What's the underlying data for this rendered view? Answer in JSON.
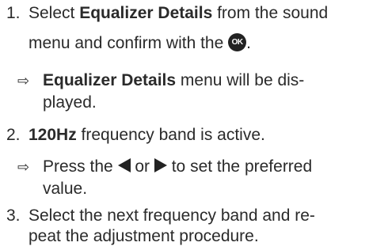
{
  "steps": [
    {
      "number": "1.",
      "line1_pre": "Select ",
      "line1_bold": "Equalizer Details",
      "line1_post": " from the sound",
      "line2_pre": "menu and confirm with the ",
      "ok_label": "OK",
      "line2_post": ".",
      "result_arrow": "⇨",
      "result_bold": "Equalizer Details",
      "result_line1_post": " menu will be dis-",
      "result_line2": "played."
    },
    {
      "number": "2.",
      "bold": "120Hz",
      "post": " frequency band is active.",
      "result_arrow": "⇨",
      "result_pre": "Press the ",
      "result_mid": " or ",
      "result_post": " to set the preferred",
      "result_line2": "value."
    },
    {
      "number": "3.",
      "line1": "Select the next frequency band and re-",
      "line2": "peat the adjustment procedure."
    }
  ],
  "icons": {
    "ok": "ok-button-icon",
    "left": "left-arrow-icon",
    "right": "right-arrow-icon",
    "result": "result-arrow-icon"
  }
}
